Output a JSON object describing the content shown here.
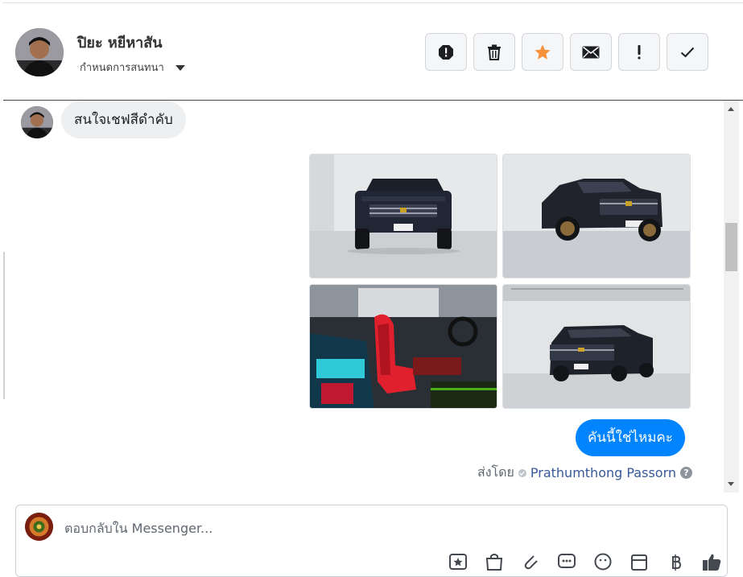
{
  "header": {
    "contact_name": "ปิยะ หยีหาสัน",
    "assign_label": "กำหนดการสนทนา",
    "actions": [
      {
        "name": "spam-button",
        "icon": "alert-octagon-icon"
      },
      {
        "name": "delete-button",
        "icon": "trash-icon"
      },
      {
        "name": "star-button",
        "icon": "star-icon"
      },
      {
        "name": "mark-unread-button",
        "icon": "envelope-icon"
      },
      {
        "name": "flag-button",
        "icon": "exclamation-icon"
      },
      {
        "name": "mark-done-button",
        "icon": "checkmark-icon"
      }
    ]
  },
  "conversation": {
    "incoming_message": "สนใจเชฟสีดำคับ",
    "photos": [
      {
        "name": "truck-front-photo"
      },
      {
        "name": "truck-three-quarter-photo"
      },
      {
        "name": "truck-interior-photo"
      },
      {
        "name": "truck-garage-photo"
      }
    ],
    "outgoing_message": "คันนี้ใช่ไหมคะ",
    "sent_by_label": "ส่งโดย",
    "sender_name": "Prathumthong Passorn",
    "help_glyph": "?"
  },
  "composer": {
    "placeholder": "ตอบกลับใน Messenger..."
  },
  "colors": {
    "accent_blue": "#0084ff",
    "star_orange": "#f7923b",
    "link_blue": "#385898"
  }
}
